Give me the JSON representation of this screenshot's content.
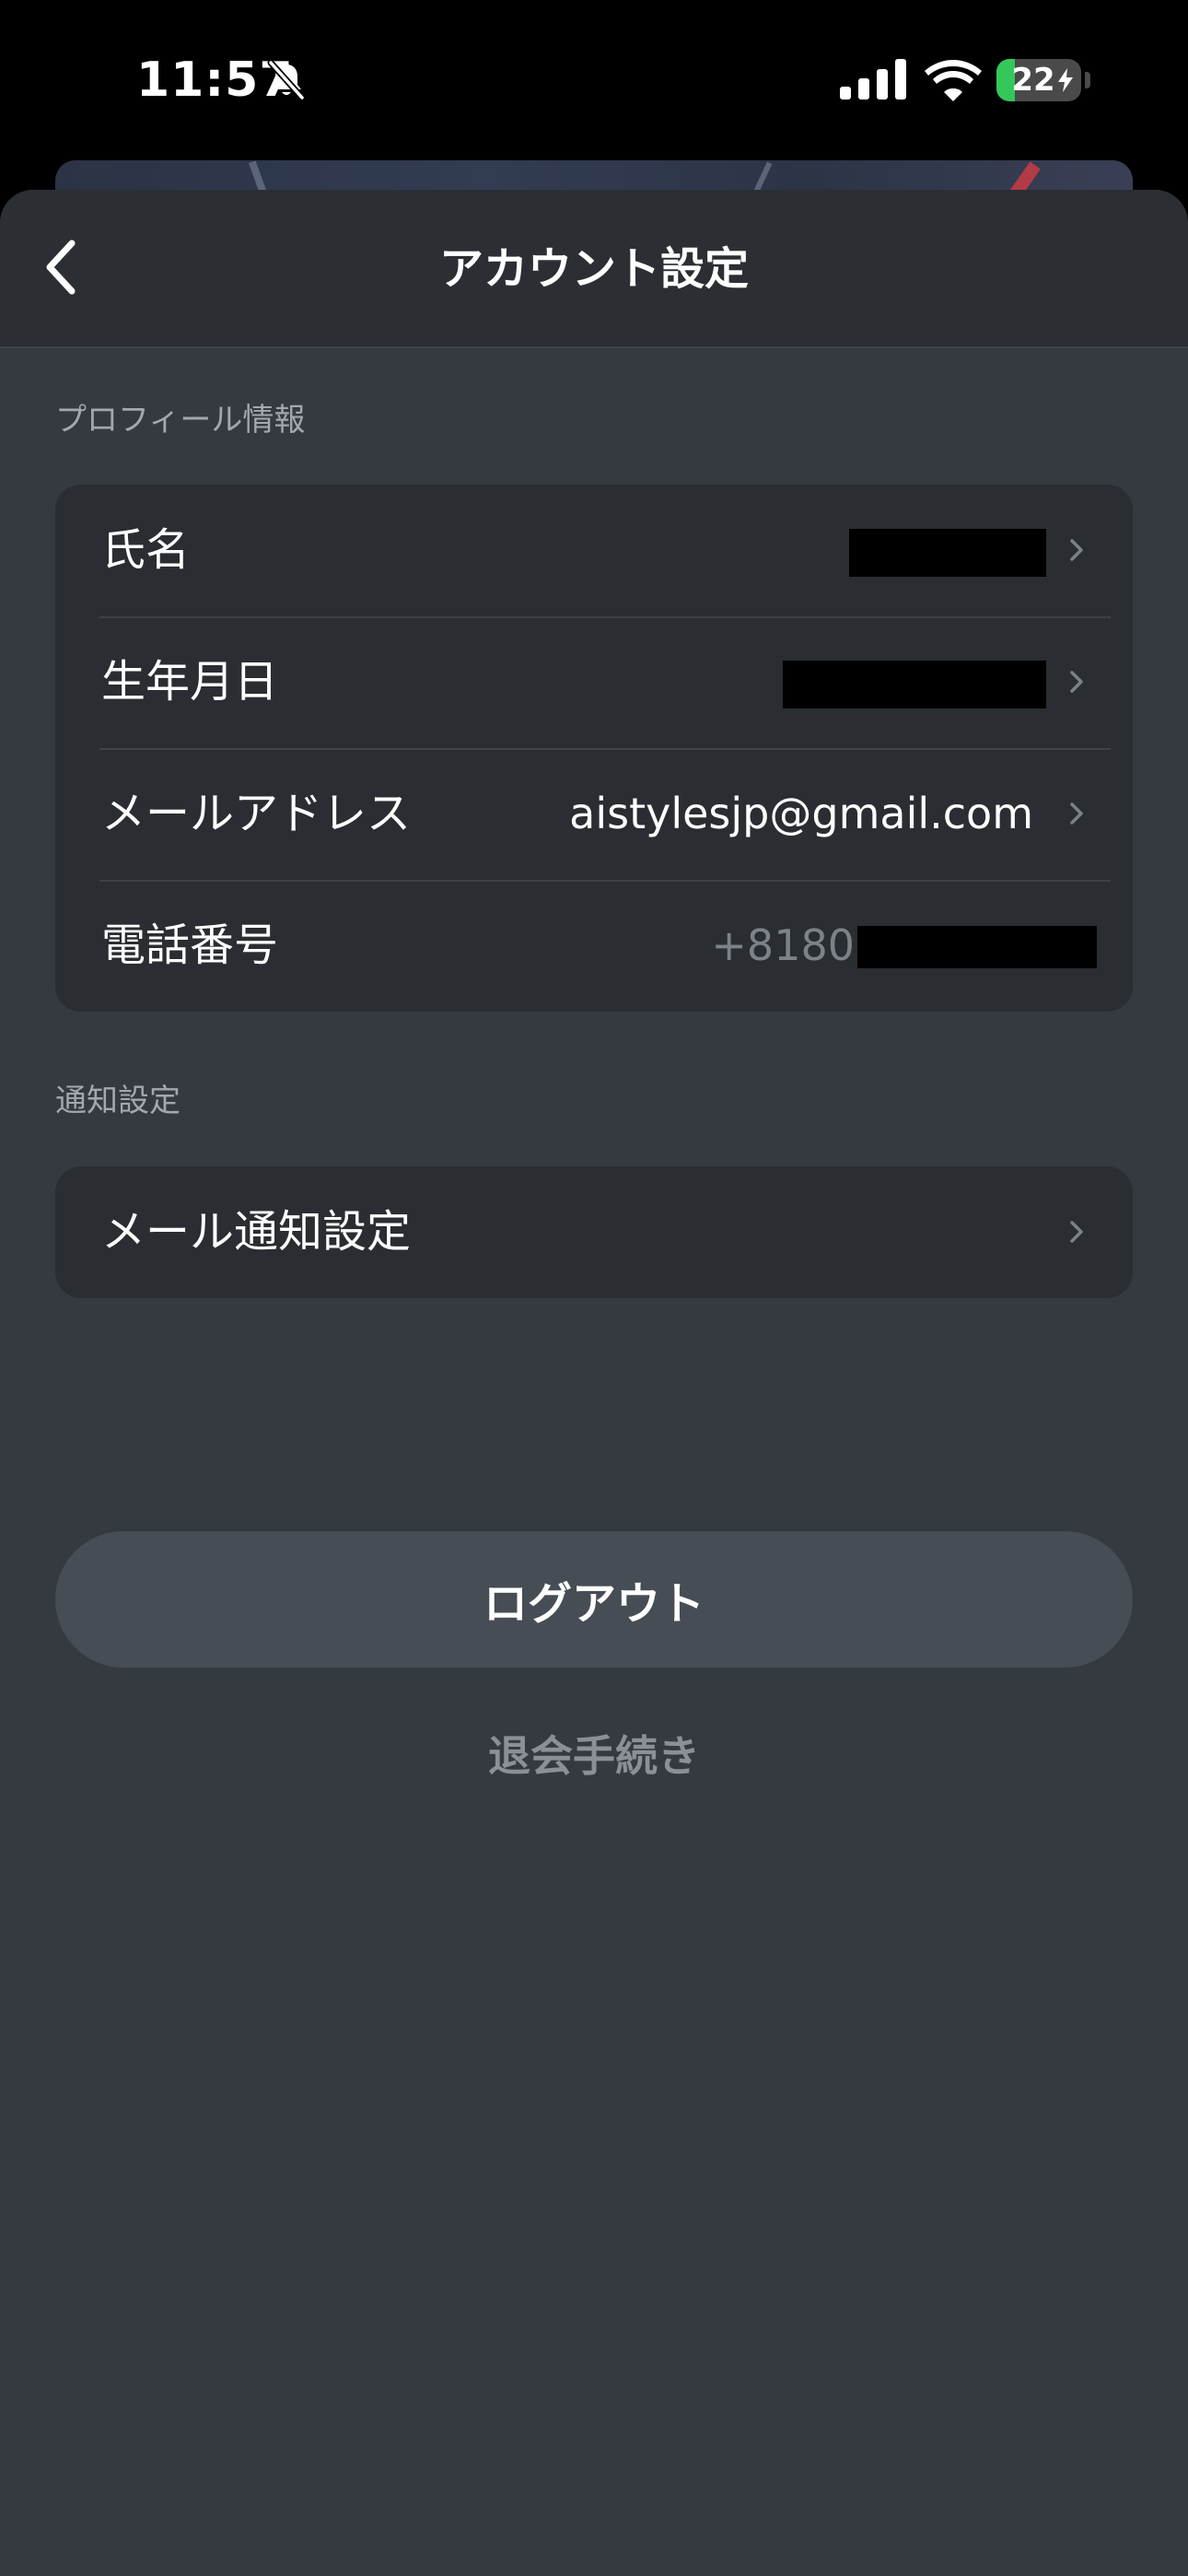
{
  "status_bar": {
    "time": "11:57",
    "battery": "22",
    "battery_level_percent": 22,
    "icons": [
      "bell-slash-icon",
      "signal-icon",
      "wifi-icon",
      "battery-charging-icon"
    ]
  },
  "nav": {
    "title": "アカウント設定",
    "back_icon": "chevron-left-icon"
  },
  "profile_section": {
    "header": "プロフィール情報",
    "rows": [
      {
        "label": "氏名",
        "value": ""
      },
      {
        "label": "生年月日",
        "value": ""
      },
      {
        "label": "メールアドレス",
        "value": "aistylesjp@gmail.com"
      },
      {
        "label": "電話番号",
        "value": "+8180"
      }
    ]
  },
  "notification_section": {
    "header": "通知設定",
    "rows": [
      {
        "label": "メール通知設定"
      }
    ]
  },
  "actions": {
    "logout_label": "ログアウト",
    "withdraw_label": "退会手続き"
  },
  "colors": {
    "background": "#353a40",
    "card": "#2a2d31",
    "nav": "#2b2f34",
    "button": "#464d54",
    "muted_text": "#8b9097",
    "battery_green": "#34c759"
  }
}
